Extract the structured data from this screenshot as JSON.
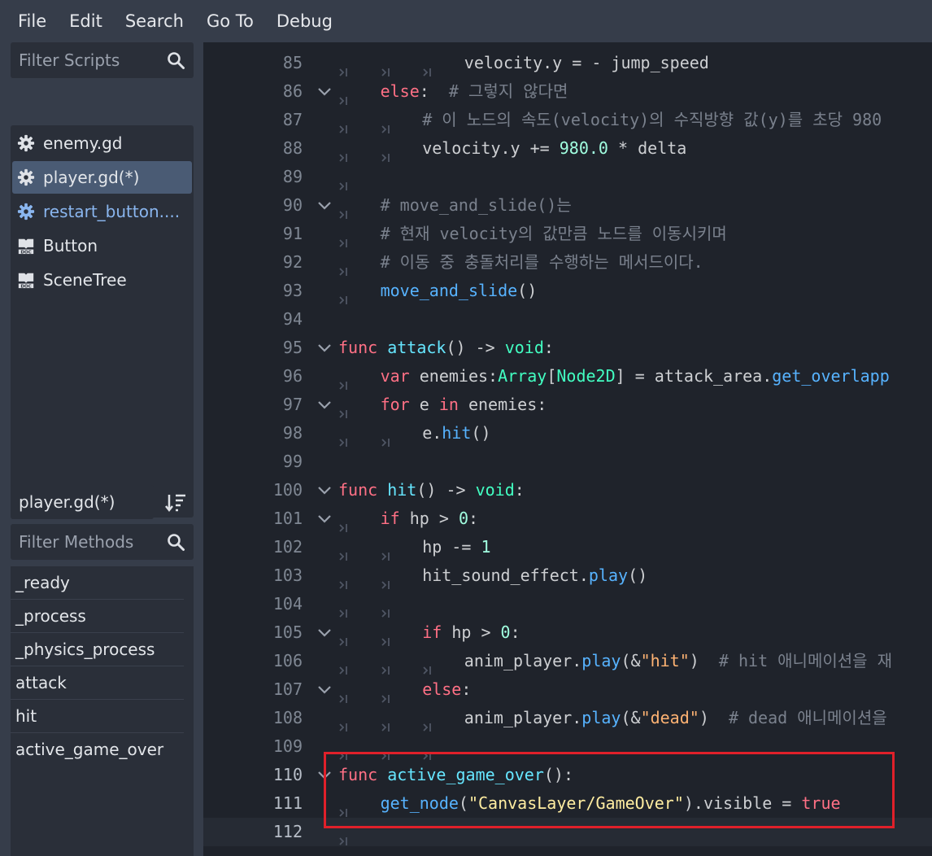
{
  "menu": [
    "File",
    "Edit",
    "Search",
    "Go To",
    "Debug"
  ],
  "left_panel": {
    "filter_scripts_placeholder": "Filter Scripts",
    "scripts": [
      {
        "name": "enemy.gd",
        "icon": "gear-icon"
      },
      {
        "name": "player.gd(*)",
        "icon": "gear-icon",
        "selected": true
      },
      {
        "name": "restart_button....",
        "icon": "gear-icon",
        "linked": true
      },
      {
        "name": "Button",
        "icon": "doc-icon"
      },
      {
        "name": "SceneTree",
        "icon": "doc-icon"
      }
    ],
    "current_script": "player.gd(*)",
    "filter_methods_placeholder": "Filter Methods",
    "methods": [
      "_ready",
      "_process",
      "_physics_process",
      "attack",
      "hit",
      "active_game_over"
    ]
  },
  "colors": {
    "background": "#363d4a",
    "editor_bg": "#1f232b",
    "keyword": "#ff7085",
    "function": "#57b3ff",
    "type": "#42ffc2",
    "string": "#ffeda1",
    "comment": "#7a818d",
    "highlight_box": "#e0202a"
  },
  "code_lines": [
    {
      "num": "85",
      "indent": 3,
      "fold": false,
      "tokens": [
        [
          "idt",
          "velocity.y = - jump_speed"
        ]
      ]
    },
    {
      "num": "86",
      "indent": 1,
      "fold": true,
      "tokens": [
        [
          "kw",
          "else"
        ],
        [
          "idt",
          ":  "
        ],
        [
          "cm",
          "# 그렇지 않다면"
        ]
      ]
    },
    {
      "num": "87",
      "indent": 2,
      "fold": false,
      "tokens": [
        [
          "cm",
          "# 이 노드의 속도(velocity)의 수직방향 값(y)를 초당 980"
        ]
      ]
    },
    {
      "num": "88",
      "indent": 2,
      "fold": false,
      "tokens": [
        [
          "idt",
          "velocity.y += "
        ],
        [
          "num",
          "980.0"
        ],
        [
          "idt",
          " * delta"
        ]
      ]
    },
    {
      "num": "89",
      "indent": 1,
      "fold": false,
      "tokens": []
    },
    {
      "num": "90",
      "indent": 1,
      "fold": true,
      "tokens": [
        [
          "cm",
          "# move_and_slide()는"
        ]
      ]
    },
    {
      "num": "91",
      "indent": 1,
      "fold": false,
      "tokens": [
        [
          "cm",
          "# 현재 velocity의 값만큼 노드를 이동시키며"
        ]
      ]
    },
    {
      "num": "92",
      "indent": 1,
      "fold": false,
      "tokens": [
        [
          "cm",
          "# 이동 중 충돌처리를 수행하는 메서드이다."
        ]
      ]
    },
    {
      "num": "93",
      "indent": 1,
      "fold": false,
      "tokens": [
        [
          "fn",
          "move_and_slide"
        ],
        [
          "idt",
          "()"
        ]
      ]
    },
    {
      "num": "94",
      "indent": 0,
      "fold": false,
      "tokens": []
    },
    {
      "num": "95",
      "indent": 0,
      "fold": true,
      "tokens": [
        [
          "kw",
          "func "
        ],
        [
          "fnd",
          "attack"
        ],
        [
          "idt",
          "() -> "
        ],
        [
          "typ",
          "void"
        ],
        [
          "idt",
          ":"
        ]
      ]
    },
    {
      "num": "96",
      "indent": 1,
      "fold": false,
      "tokens": [
        [
          "kw",
          "var"
        ],
        [
          "idt",
          " enemies:"
        ],
        [
          "typ",
          "Array"
        ],
        [
          "idt",
          "["
        ],
        [
          "typ",
          "Node2D"
        ],
        [
          "idt",
          "] = attack_area."
        ],
        [
          "fn",
          "get_overlapp"
        ]
      ]
    },
    {
      "num": "97",
      "indent": 1,
      "fold": true,
      "tokens": [
        [
          "kw",
          "for"
        ],
        [
          "idt",
          " e "
        ],
        [
          "kw",
          "in"
        ],
        [
          "idt",
          " enemies:"
        ]
      ]
    },
    {
      "num": "98",
      "indent": 2,
      "fold": false,
      "tokens": [
        [
          "idt",
          "e."
        ],
        [
          "fn",
          "hit"
        ],
        [
          "idt",
          "()"
        ]
      ]
    },
    {
      "num": "99",
      "indent": 0,
      "fold": false,
      "tokens": []
    },
    {
      "num": "100",
      "indent": 0,
      "fold": true,
      "tokens": [
        [
          "kw",
          "func "
        ],
        [
          "fnd",
          "hit"
        ],
        [
          "idt",
          "() -> "
        ],
        [
          "typ",
          "void"
        ],
        [
          "idt",
          ":"
        ]
      ]
    },
    {
      "num": "101",
      "indent": 1,
      "fold": true,
      "tokens": [
        [
          "kw",
          "if"
        ],
        [
          "idt",
          " hp > "
        ],
        [
          "num",
          "0"
        ],
        [
          "idt",
          ":"
        ]
      ]
    },
    {
      "num": "102",
      "indent": 2,
      "fold": false,
      "tokens": [
        [
          "idt",
          "hp -= "
        ],
        [
          "num",
          "1"
        ]
      ]
    },
    {
      "num": "103",
      "indent": 2,
      "fold": false,
      "tokens": [
        [
          "idt",
          "hit_sound_effect."
        ],
        [
          "fn",
          "play"
        ],
        [
          "idt",
          "()"
        ]
      ]
    },
    {
      "num": "104",
      "indent": 2,
      "fold": false,
      "tokens": []
    },
    {
      "num": "105",
      "indent": 2,
      "fold": true,
      "tokens": [
        [
          "kw",
          "if"
        ],
        [
          "idt",
          " hp > "
        ],
        [
          "num",
          "0"
        ],
        [
          "idt",
          ":"
        ]
      ]
    },
    {
      "num": "106",
      "indent": 3,
      "fold": false,
      "tokens": [
        [
          "idt",
          "anim_player."
        ],
        [
          "fn",
          "play"
        ],
        [
          "idt",
          "(&"
        ],
        [
          "sn",
          "\"hit\""
        ],
        [
          "idt",
          ")  "
        ],
        [
          "cm",
          "# hit 애니메이션을 재"
        ]
      ]
    },
    {
      "num": "107",
      "indent": 2,
      "fold": true,
      "tokens": [
        [
          "kw",
          "else"
        ],
        [
          "idt",
          ":"
        ]
      ]
    },
    {
      "num": "108",
      "indent": 3,
      "fold": false,
      "tokens": [
        [
          "idt",
          "anim_player."
        ],
        [
          "fn",
          "play"
        ],
        [
          "idt",
          "(&"
        ],
        [
          "sn",
          "\"dead\""
        ],
        [
          "idt",
          ")  "
        ],
        [
          "cm",
          "# dead 애니메이션을"
        ]
      ]
    },
    {
      "num": "109",
      "indent": 3,
      "fold": false,
      "tokens": []
    },
    {
      "num": "110",
      "indent": 0,
      "fold": true,
      "tokens": [
        [
          "kw",
          "func "
        ],
        [
          "fnd",
          "active_game_over"
        ],
        [
          "idt",
          "():"
        ]
      ]
    },
    {
      "num": "111",
      "indent": 1,
      "fold": false,
      "tokens": [
        [
          "fn",
          "get_node"
        ],
        [
          "idt",
          "("
        ],
        [
          "str",
          "\"CanvasLayer/GameOver\""
        ],
        [
          "idt",
          ").visible = "
        ],
        [
          "kw",
          "true"
        ]
      ]
    },
    {
      "num": "112",
      "indent": 1,
      "fold": false,
      "current": true,
      "tokens": []
    }
  ]
}
